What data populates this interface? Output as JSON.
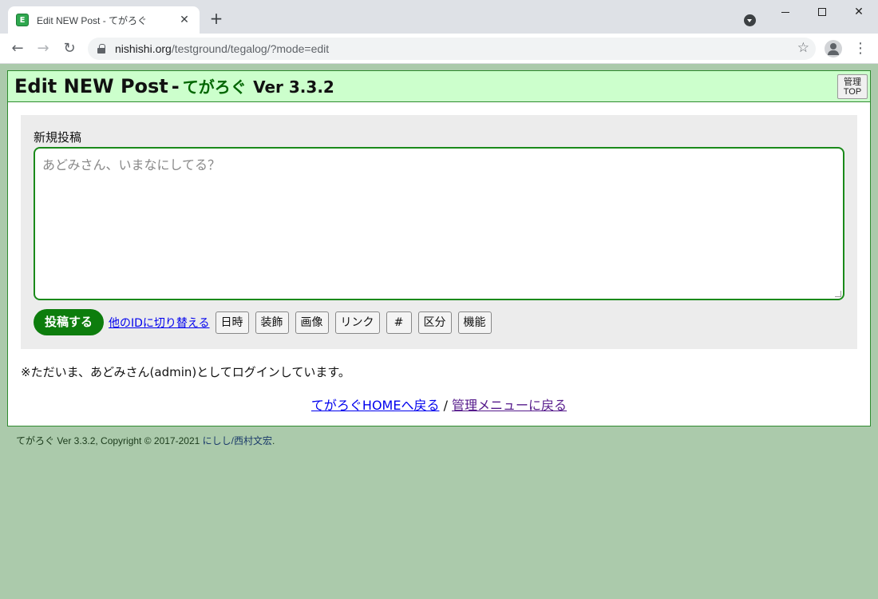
{
  "browser": {
    "tab_title": "Edit NEW Post - てがろぐ",
    "tab_close": "✕",
    "new_tab": "+",
    "favicon_text": "E",
    "url_host": "nishishi.org",
    "url_path": "/testground/tegalog/?mode=edit",
    "back": "←",
    "forward": "→",
    "reload": "↻",
    "star": "☆",
    "menu": "⋮",
    "close": "✕"
  },
  "header": {
    "title_main": "Edit NEW Post",
    "title_sep": "-",
    "app_name": "てがろぐ",
    "version": "Ver 3.3.2",
    "admin_top_line1": "管理",
    "admin_top_line2": "TOP"
  },
  "form": {
    "label": "新規投稿",
    "placeholder": "あどみさん、いまなにしてる？",
    "post_button": "投稿する",
    "switch_id_link": "他のIDに切り替える",
    "tools": [
      "日時",
      "装飾",
      "画像",
      "リンク",
      "#",
      "区分",
      "機能"
    ]
  },
  "status": {
    "login_note": "※ただいま、あどみさん(admin)としてログインしています。"
  },
  "links": {
    "home": "てがろぐHOMEへ戻る",
    "separator": "/",
    "admin_menu": "管理メニューに戻る"
  },
  "footer": {
    "copyright_prefix": "てがろぐ Ver 3.3.2, Copyright © 2017-2021 ",
    "author": "にしし/西村文宏",
    "suffix": "."
  },
  "colors": {
    "page_bg": "#abcaab",
    "header_bg": "#ccffcc",
    "accent_green": "#0d7d0d",
    "link_blue": "#0000ee",
    "link_visited": "#551a8b"
  }
}
